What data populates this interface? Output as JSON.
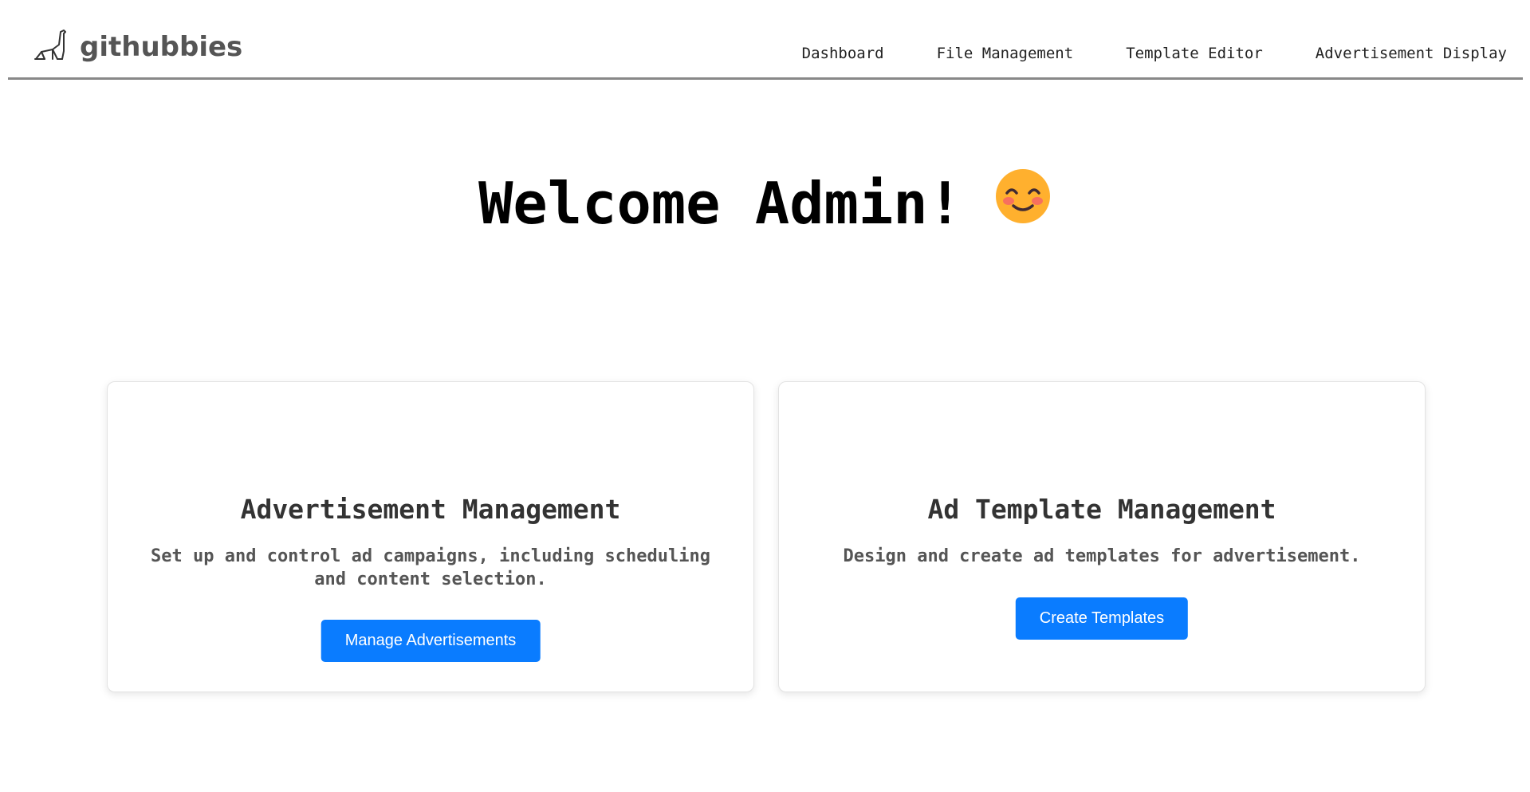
{
  "header": {
    "logo_text": "githubbies",
    "nav": [
      {
        "label": "Dashboard"
      },
      {
        "label": "File Management"
      },
      {
        "label": "Template Editor"
      },
      {
        "label": "Advertisement Display"
      }
    ]
  },
  "main": {
    "welcome": "Welcome Admin!",
    "cards": [
      {
        "title": "Advertisement Management",
        "description": "Set up and control ad campaigns, including scheduling and content selection.",
        "button": "Manage Advertisements"
      },
      {
        "title": "Ad Template Management",
        "description": "Design and create ad templates for advertisement.",
        "button": "Create Templates"
      }
    ]
  },
  "colors": {
    "accent": "#0a7cff",
    "divider": "#888888",
    "logo": "#555555"
  },
  "icons": {
    "logo": "dinosaur-icon",
    "welcome": "smiling-face-icon"
  }
}
